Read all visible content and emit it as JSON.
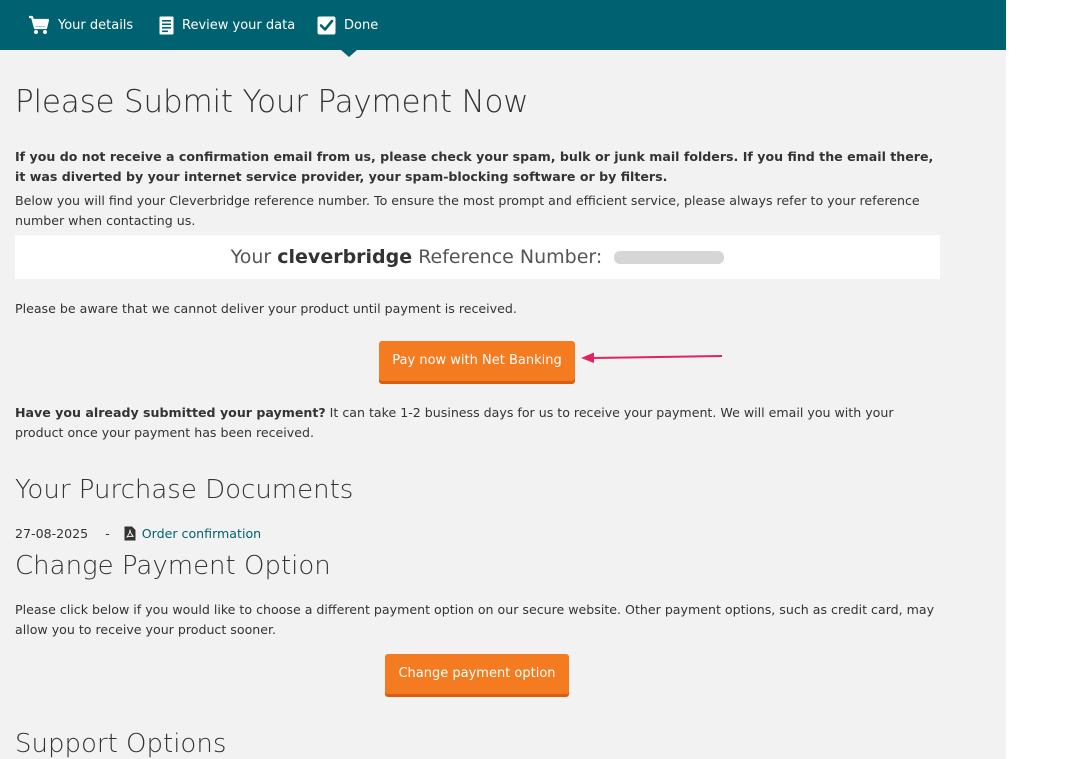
{
  "steps": [
    {
      "label": "Your details",
      "icon": "cart-icon"
    },
    {
      "label": "Review your data",
      "icon": "document-icon"
    },
    {
      "label": "Done",
      "icon": "checkbox-icon"
    }
  ],
  "main": {
    "title": "Please Submit Your Payment Now",
    "warning": "If you do not receive a confirmation email from us, please check your spam, bulk or junk mail folders. If you find the email there, it was diverted by your internet service provider, your spam-blocking software or by filters.",
    "reference_intro": "Below you will find your Cleverbridge reference number. To ensure the most prompt and efficient service, please always refer to your reference number when contacting us.",
    "reference": {
      "prefix": "Your",
      "brand": "cleverbridge",
      "suffix": "Reference Number:"
    },
    "delivery_note": "Please be aware that we cannot deliver your product until payment is received.",
    "pay_button": "Pay now with Net Banking",
    "submitted_question": "Have you already submitted your payment?",
    "submitted_text": " It can take 1-2 business days for us to receive your payment. We will email you with your product once your payment has been received."
  },
  "documents": {
    "heading": "Your Purchase Documents",
    "items": [
      {
        "date": "27-08-2025",
        "separator": "-",
        "link": "Order confirmation",
        "icon": "pdf-icon"
      }
    ]
  },
  "change_payment": {
    "heading": "Change Payment Option",
    "text": "Please click below if you would like to choose a different payment option on our secure website. Other payment options, such as credit card, may allow you to receive your product sooner.",
    "button": "Change payment option"
  },
  "support": {
    "heading": "Support Options"
  },
  "colors": {
    "header": "#006170",
    "accent_button": "#f47b20",
    "link": "#006170",
    "annotation_arrow": "#e0245e"
  }
}
